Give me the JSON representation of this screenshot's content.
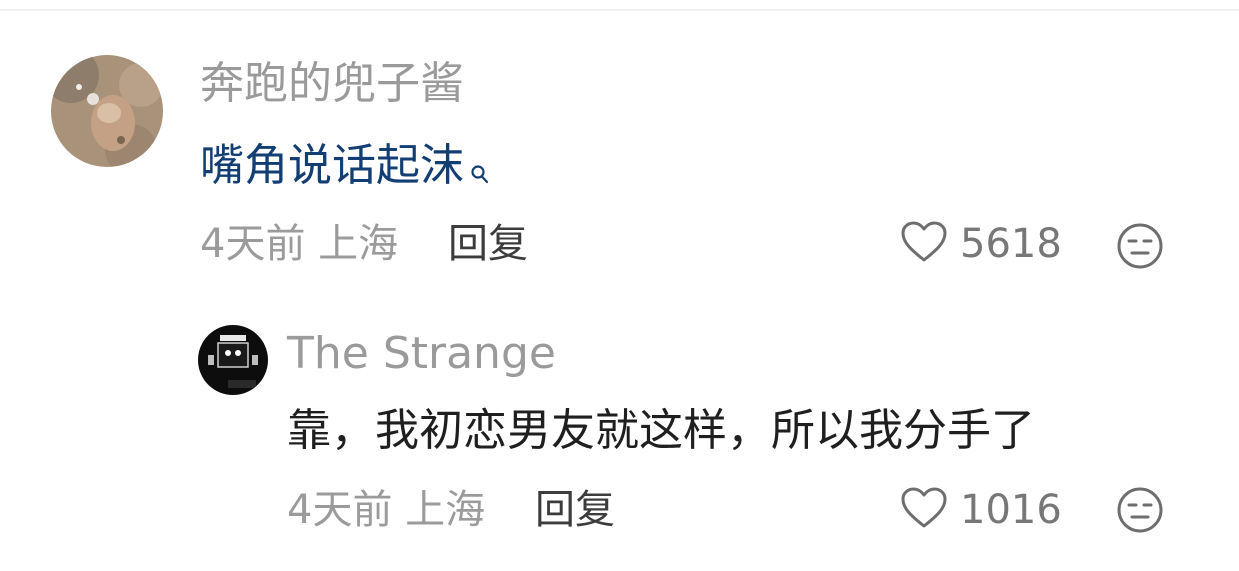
{
  "comments": [
    {
      "author": "奔跑的兜子酱",
      "content": "嘴角说话起沫",
      "search_icon": "search-icon",
      "time": "4天前",
      "location": "上海",
      "reply_label": "回复",
      "likes": "5618",
      "avatar": "animal-photo-avatar"
    },
    {
      "author": "The Strange",
      "content": "靠，我初恋男友就这样，所以我分手了",
      "time": "4天前",
      "location": "上海",
      "reply_label": "回复",
      "likes": "1016",
      "avatar": "dark-character-avatar"
    }
  ],
  "colors": {
    "link_text": "#123e74",
    "name_text": "#9a9a9a",
    "meta_text": "#9b9b9b"
  }
}
